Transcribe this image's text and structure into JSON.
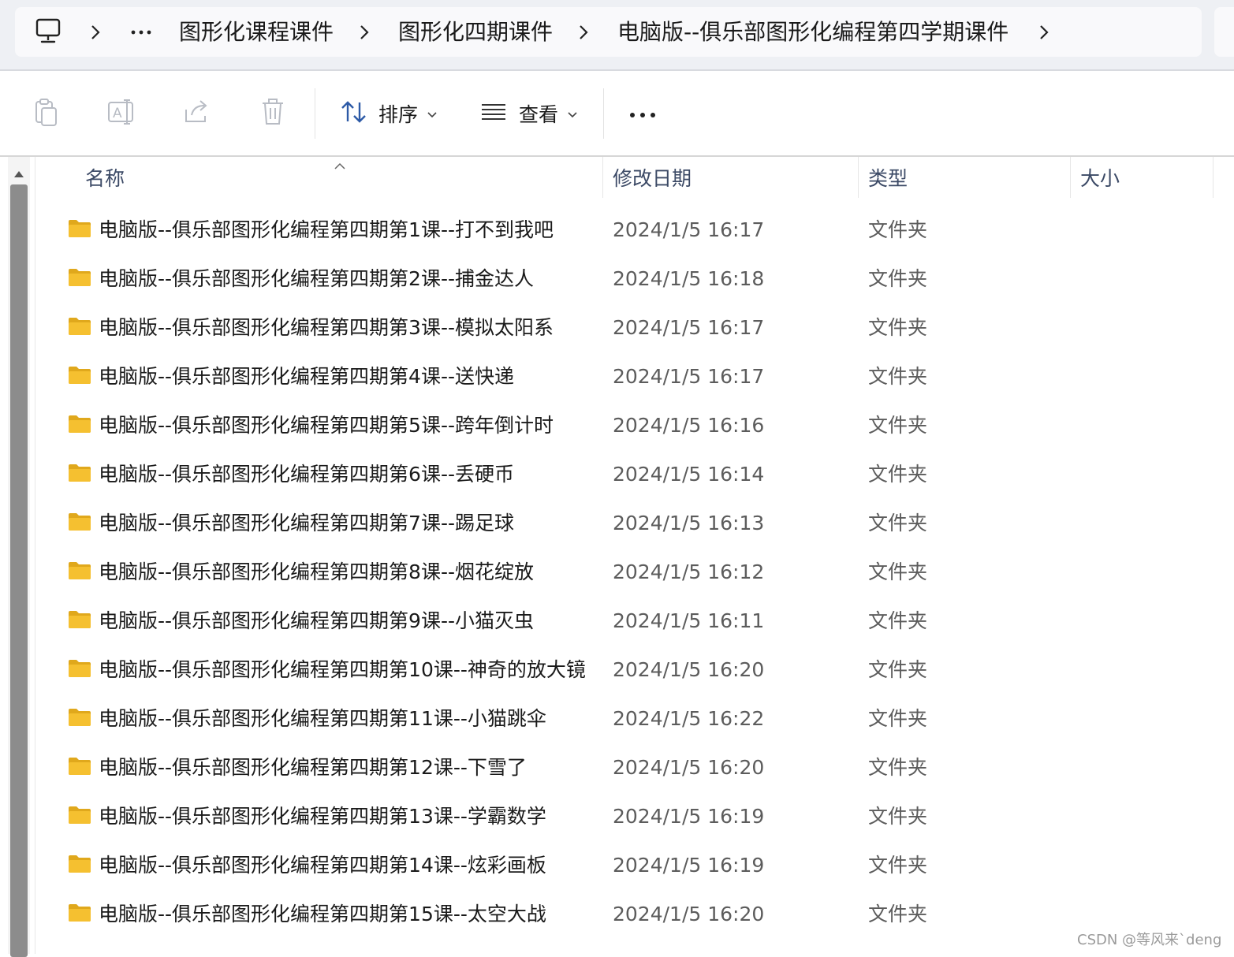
{
  "address_bar": {
    "ellipsis": "···",
    "crumbs": [
      "图形化课程课件",
      "图形化四期课件",
      "电脑版--俱乐部图形化编程第四学期课件"
    ]
  },
  "command_bar": {
    "sort_label": "排序",
    "view_label": "查看"
  },
  "columns": {
    "name": "名称",
    "date": "修改日期",
    "type": "类型",
    "size": "大小"
  },
  "files": [
    {
      "name": "电脑版--俱乐部图形化编程第四期第1课--打不到我吧",
      "date": "2024/1/5 16:17",
      "type": "文件夹"
    },
    {
      "name": "电脑版--俱乐部图形化编程第四期第2课--捕金达人",
      "date": "2024/1/5 16:18",
      "type": "文件夹"
    },
    {
      "name": "电脑版--俱乐部图形化编程第四期第3课--模拟太阳系",
      "date": "2024/1/5 16:17",
      "type": "文件夹"
    },
    {
      "name": "电脑版--俱乐部图形化编程第四期第4课--送快递",
      "date": "2024/1/5 16:17",
      "type": "文件夹"
    },
    {
      "name": "电脑版--俱乐部图形化编程第四期第5课--跨年倒计时",
      "date": "2024/1/5 16:16",
      "type": "文件夹"
    },
    {
      "name": "电脑版--俱乐部图形化编程第四期第6课--丢硬币",
      "date": "2024/1/5 16:14",
      "type": "文件夹"
    },
    {
      "name": "电脑版--俱乐部图形化编程第四期第7课--踢足球",
      "date": "2024/1/5 16:13",
      "type": "文件夹"
    },
    {
      "name": "电脑版--俱乐部图形化编程第四期第8课--烟花绽放",
      "date": "2024/1/5 16:12",
      "type": "文件夹"
    },
    {
      "name": "电脑版--俱乐部图形化编程第四期第9课--小猫灭虫",
      "date": "2024/1/5 16:11",
      "type": "文件夹"
    },
    {
      "name": "电脑版--俱乐部图形化编程第四期第10课--神奇的放大镜",
      "date": "2024/1/5 16:20",
      "type": "文件夹"
    },
    {
      "name": "电脑版--俱乐部图形化编程第四期第11课--小猫跳伞",
      "date": "2024/1/5 16:22",
      "type": "文件夹"
    },
    {
      "name": "电脑版--俱乐部图形化编程第四期第12课--下雪了",
      "date": "2024/1/5 16:20",
      "type": "文件夹"
    },
    {
      "name": "电脑版--俱乐部图形化编程第四期第13课--学霸数学",
      "date": "2024/1/5 16:19",
      "type": "文件夹"
    },
    {
      "name": "电脑版--俱乐部图形化编程第四期第14课--炫彩画板",
      "date": "2024/1/5 16:19",
      "type": "文件夹"
    },
    {
      "name": "电脑版--俱乐部图形化编程第四期第15课--太空大战",
      "date": "2024/1/5 16:20",
      "type": "文件夹"
    }
  ],
  "watermark": "CSDN @等风来`deng",
  "colors": {
    "folder": "#f5c030",
    "folder_dark": "#e0a81c",
    "header_text": "#3c4a66"
  }
}
